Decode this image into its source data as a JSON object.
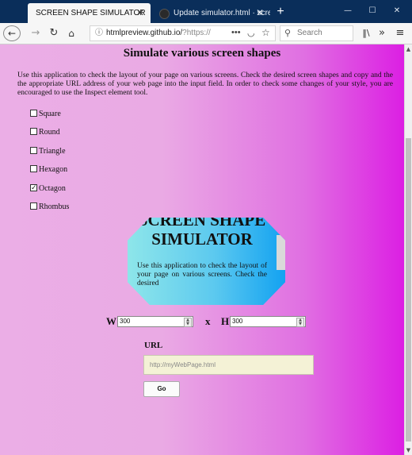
{
  "browser": {
    "tabs": [
      {
        "title": "SCREEN SHAPE SIMULATOR",
        "active": true
      },
      {
        "title": "Update simulator.html · screen",
        "active": false
      }
    ],
    "window_controls": {
      "minimize": "—",
      "maximize": "☐",
      "close": "✕"
    },
    "url_prefix": "htmlpreview.github.io/",
    "url_dim": "?https://",
    "search_placeholder": "Search",
    "menu_dots": "•••"
  },
  "page": {
    "heading": "Simulate various screen shapes",
    "intro": "Use this application to check the layout of your page on various screens. Check the desired screen shapes and copy and the the appropriate URL address of your web page into the input field. In order to check some changes of your style, you are encouraged to use the Inspect element tool.",
    "shapes": [
      {
        "label": "Square",
        "checked": false
      },
      {
        "label": "Round",
        "checked": false
      },
      {
        "label": "Triangle",
        "checked": false
      },
      {
        "label": "Hexagon",
        "checked": false
      },
      {
        "label": "Octagon",
        "checked": true
      },
      {
        "label": "Rhombus",
        "checked": false
      }
    ],
    "preview": {
      "title": "SCREEN SHAPE SIMULATOR",
      "text": "Use this application to check the layout of your page on various screens. Check the desired"
    },
    "width_label": "W",
    "width_value": "300",
    "separator": "x",
    "height_label": "H",
    "height_value": "300",
    "url_label": "URL",
    "url_placeholder": "http://myWebPage.html",
    "go_label": "Go"
  },
  "colors": {
    "titlebar": "#0a2e5a",
    "page_gradient_start": "#ebaee6",
    "page_gradient_end": "#dc1fe3",
    "preview_gradient_start": "#8ee6ea",
    "preview_gradient_end": "#13a2f1",
    "url_input_bg": "#f4f2d6"
  }
}
